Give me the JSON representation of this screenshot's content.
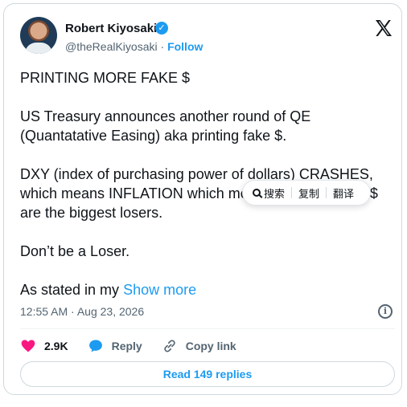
{
  "author": {
    "name": "Robert Kiyosaki",
    "handle": "@theRealKiyosaki",
    "separator": "·",
    "follow_label": "Follow"
  },
  "post": {
    "paragraphs": [
      "PRINTING MORE FAKE $",
      "US Treasury announces another round of QE (Quantatative Easing) aka printing fake $.",
      "DXY (index of purchasing power of dollars) CRASHES, which means INFLATION which means savers of fake $ are the biggest losers.",
      "Don’t be a Loser."
    ],
    "truncated_text": "As stated in my ",
    "show_more_label": "Show more",
    "timestamp": "12:55 AM · Aug 23, 2026"
  },
  "context_menu": {
    "search_label": "搜索",
    "copy_label": "复制",
    "translate_label": "翻译"
  },
  "actions": {
    "like_count": "2.9K",
    "reply_label": "Reply",
    "copy_link_label": "Copy link"
  },
  "replies_button": "Read 149 replies",
  "colors": {
    "accent": "#1d9bf0",
    "like": "#f91880",
    "text": "#0f1419",
    "muted": "#536471"
  },
  "icons": [
    "verified-badge-icon",
    "x-logo-icon",
    "info-icon",
    "heart-icon",
    "reply-bubble-icon",
    "link-icon",
    "search-icon"
  ]
}
